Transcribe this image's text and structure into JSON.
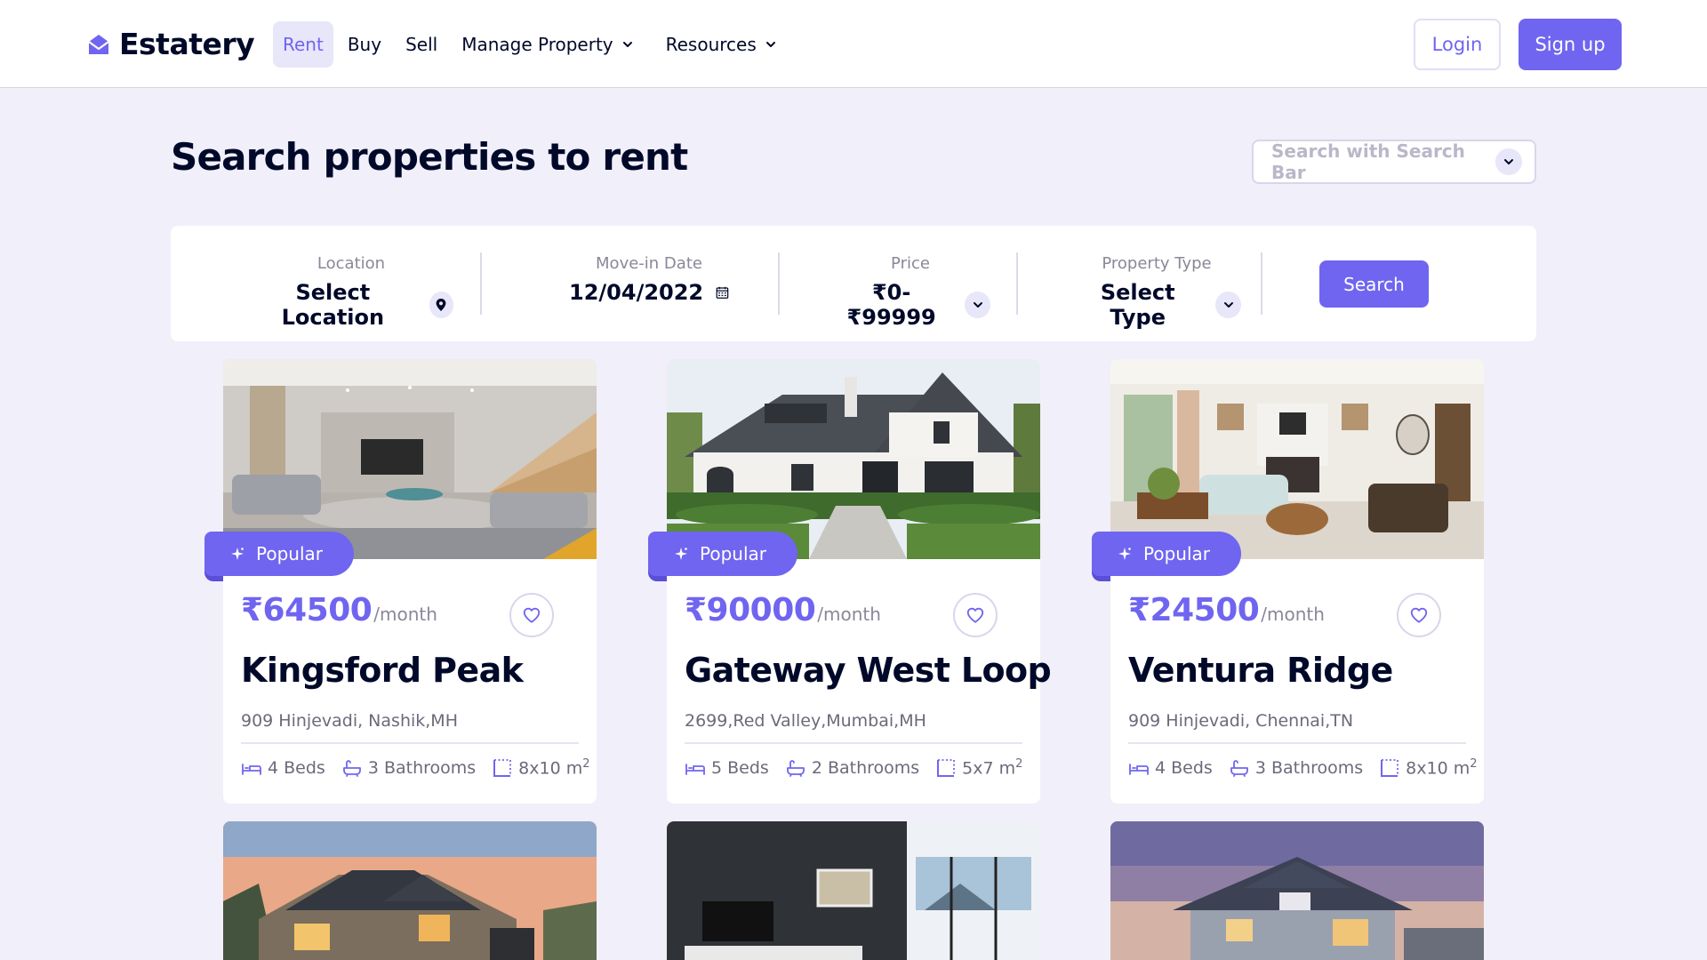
{
  "brand": {
    "name": "Estatery",
    "accent": "#7065f0"
  },
  "nav": {
    "items": [
      {
        "label": "Rent",
        "active": true
      },
      {
        "label": "Buy"
      },
      {
        "label": "Sell"
      },
      {
        "label": "Manage Property",
        "dropdown": true
      },
      {
        "label": "Resources",
        "dropdown": true
      }
    ],
    "login": "Login",
    "signup": "Sign up"
  },
  "page": {
    "title": "Search properties to rent",
    "search_placeholder": "Search with Search Bar"
  },
  "filters": {
    "location": {
      "label": "Location",
      "value": "Select Location"
    },
    "date": {
      "label": "Move-in Date",
      "value": "12/04/2022"
    },
    "price": {
      "label": "Price",
      "value": "₹0-₹99999"
    },
    "type": {
      "label": "Property Type",
      "value": "Select Type"
    },
    "search_button": "Search"
  },
  "listings": [
    {
      "badge": "Popular",
      "price": "₹64500",
      "per": "/month",
      "name": "Kingsford Peak",
      "address": "909 Hinjevadi, Nashik,MH",
      "beds": "4 Beds",
      "baths": "3 Bathrooms",
      "size": "8x10 m",
      "size_unit_sup": "2",
      "image": "modern-living-room-with-stairs"
    },
    {
      "badge": "Popular",
      "price": "₹90000",
      "per": "/month",
      "name": "Gateway West Loop",
      "address": "2699,Red Valley,Mumbai,MH",
      "beds": "5 Beds",
      "baths": "2 Bathrooms",
      "size": "5x7 m",
      "size_unit_sup": "2",
      "image": "white-farmhouse-exterior"
    },
    {
      "badge": "Popular",
      "price": "₹24500",
      "per": "/month",
      "name": "Ventura Ridge",
      "address": "909 Hinjevadi, Chennai,TN",
      "beds": "4 Beds",
      "baths": "3 Bathrooms",
      "size": "8x10 m",
      "size_unit_sup": "2",
      "image": "bright-living-room-fireplace"
    },
    {
      "image": "suburban-house-sunset"
    },
    {
      "image": "grey-living-room-tv"
    },
    {
      "image": "two-storey-house-dusk"
    }
  ]
}
